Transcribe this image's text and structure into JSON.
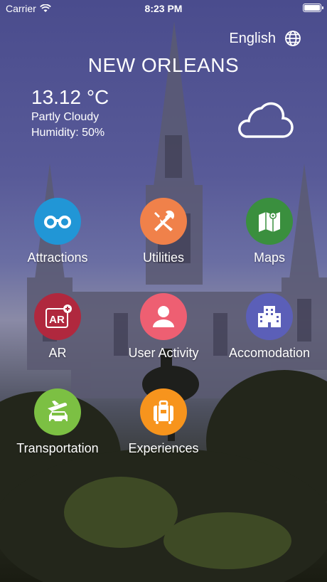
{
  "status_bar": {
    "carrier": "Carrier",
    "time": "8:23 PM"
  },
  "language": {
    "label": "English"
  },
  "city": "NEW ORLEANS",
  "weather": {
    "temperature": "13.12 °C",
    "condition": "Partly Cloudy",
    "humidity": "Humidity: 50%",
    "icon": "cloud-icon"
  },
  "menu": [
    {
      "label": "Attractions",
      "icon": "binoculars-icon",
      "color": "#2196d6"
    },
    {
      "label": "Utilities",
      "icon": "tools-icon",
      "color": "#f0814a"
    },
    {
      "label": "Maps",
      "icon": "map-icon",
      "color": "#3a8f3e"
    },
    {
      "label": "AR",
      "icon": "ar-icon",
      "color": "#b0283e"
    },
    {
      "label": "User Activity",
      "icon": "user-icon",
      "color": "#ee5f72"
    },
    {
      "label": "Accomodation",
      "icon": "building-icon",
      "color": "#5b5fb8"
    },
    {
      "label": "Transportation",
      "icon": "transport-icon",
      "color": "#7cc043"
    },
    {
      "label": "Experiences",
      "icon": "luggage-icon",
      "color": "#f7941d"
    }
  ]
}
